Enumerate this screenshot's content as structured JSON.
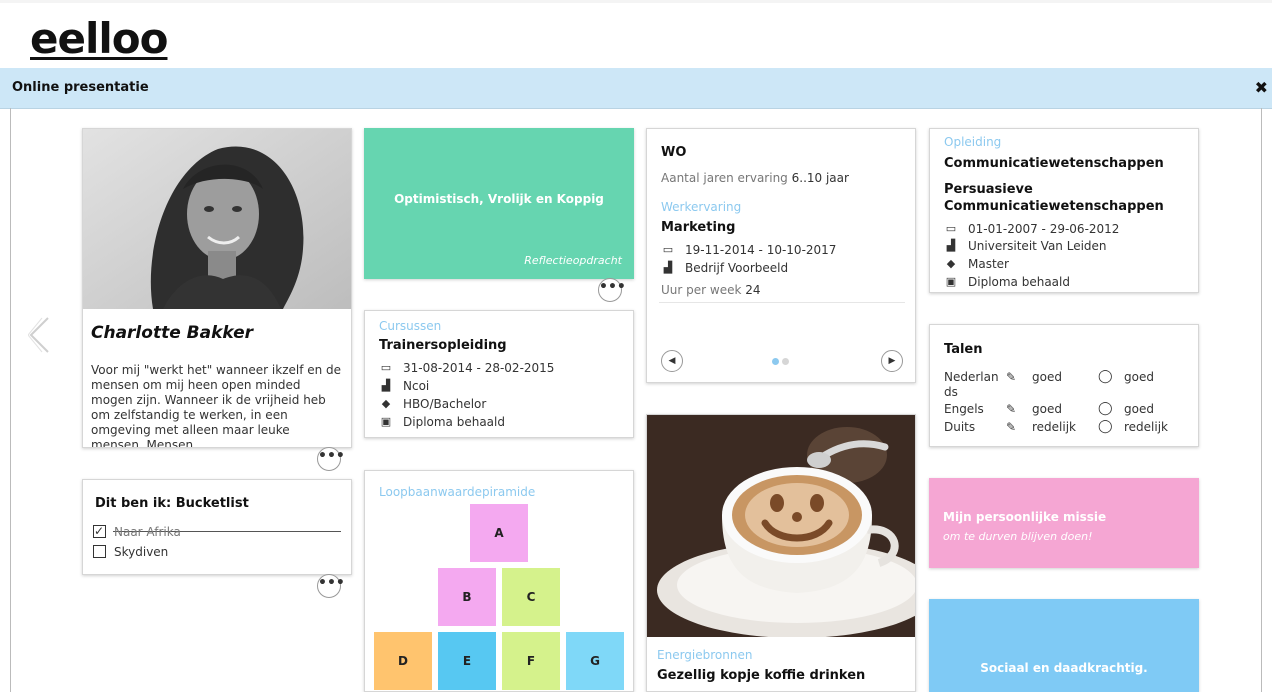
{
  "app": {
    "logo": "eelloo"
  },
  "bar": {
    "title": "Online presentatie",
    "close_glyph": "✖"
  },
  "profile": {
    "name": "Charlotte Bakker",
    "description": "Voor mij \"werkt het\" wanneer ikzelf en de mensen om mij heen open minded mogen zijn. Wanneer ik de vrijheid heb om zelfstandig te werken, in een omgeving met alleen maar leuke mensen. Mensen...",
    "more_glyph": "•••"
  },
  "bucketlist": {
    "title": "Dit ben ik: Bucketlist",
    "items": [
      {
        "label": "Naar Afrika",
        "checked": true
      },
      {
        "label": "Skydiven",
        "checked": false
      }
    ],
    "more_glyph": "•••"
  },
  "trait": {
    "text": "Optimistisch, Vrolijk en Koppig",
    "sub": "Reflectieopdracht",
    "color": "#66d5b0",
    "more_glyph": "•••"
  },
  "cursussen": {
    "section": "Cursussen",
    "title": "Trainersopleiding",
    "date": "31-08-2014 - 28-02-2015",
    "org": "Ncoi",
    "level": "HBO/Bachelor",
    "diploma": "Diploma behaald"
  },
  "pyramid": {
    "section": "Loopbaanwaardepiramide",
    "tiles": [
      {
        "label": "A",
        "color": "#f4a9f0"
      },
      {
        "label": "B",
        "color": "#f4a9f0"
      },
      {
        "label": "C",
        "color": "#d5f28c"
      },
      {
        "label": "D",
        "color": "#ffc46e"
      },
      {
        "label": "E",
        "color": "#57c8f2"
      },
      {
        "label": "F",
        "color": "#d5f28c"
      },
      {
        "label": "G",
        "color": "#7fd8f8"
      }
    ]
  },
  "werk": {
    "level": "WO",
    "exp_label": "Aantal jaren ervaring",
    "exp_value": "6..10 jaar",
    "section": "Werkervaring",
    "title": "Marketing",
    "date": "19-11-2014 - 10-10-2017",
    "company": "Bedrijf Voorbeeld",
    "hours_label": "Uur per week",
    "hours_value": "24",
    "prev_glyph": "◀",
    "next_glyph": "▶"
  },
  "energie": {
    "section": "Energiebronnen",
    "title": "Gezellig kopje koffie drinken"
  },
  "opleiding": {
    "section": "Opleiding",
    "title1": "Communicatiewetenschappen",
    "title2": "Persuasieve Communicatiewetenschappen",
    "date": "01-01-2007 - 29-06-2012",
    "school": "Universiteit Van Leiden",
    "level": "Master",
    "diploma": "Diploma behaald"
  },
  "talen": {
    "title": "Talen",
    "rows": [
      {
        "lang": "Nederlan ds",
        "write": "goed",
        "speak": "goed"
      },
      {
        "lang": "Engels",
        "write": "goed",
        "speak": "goed"
      },
      {
        "lang": "Duits",
        "write": "redelijk",
        "speak": "redelijk"
      }
    ]
  },
  "missie": {
    "title": "Mijn persoonlijke missie",
    "sub": "om te durven blijven doen!",
    "color": "#f5a6d3"
  },
  "sociaal": {
    "text": "Sociaal en daadkrachtig.",
    "color": "#7fcaf5"
  }
}
